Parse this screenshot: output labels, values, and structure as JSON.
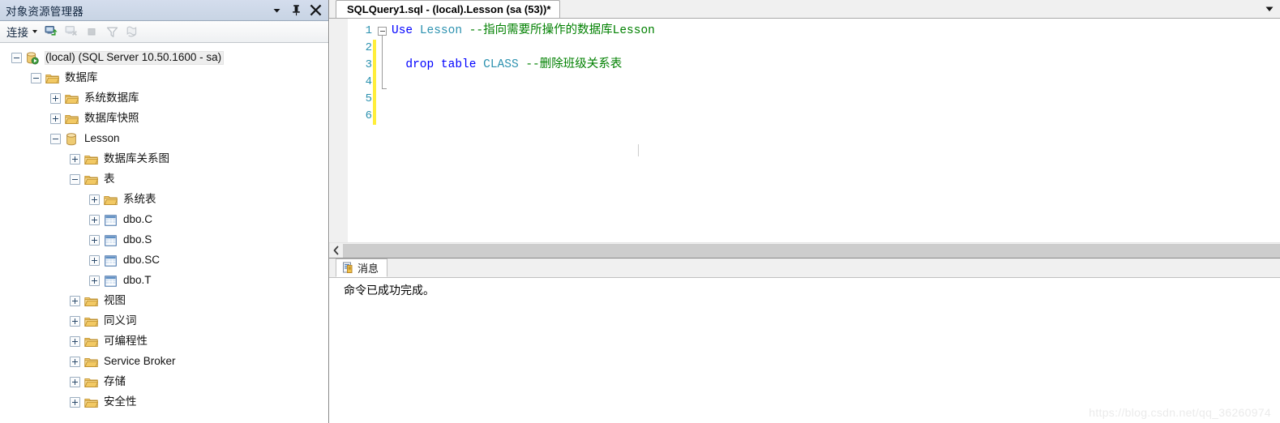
{
  "object_explorer": {
    "title": "对象资源管理器",
    "titlebar_buttons": [
      {
        "name": "window-menu-dropdown",
        "icon": "chevron-down-icon"
      },
      {
        "name": "auto-hide-pin",
        "icon": "pin-icon"
      },
      {
        "name": "close-panel",
        "icon": "close-icon"
      }
    ],
    "toolbar": {
      "connect_label": "连接",
      "buttons": [
        {
          "name": "connect-object-explorer",
          "icon": "connect-server-icon",
          "enabled": true
        },
        {
          "name": "disconnect-object-explorer",
          "icon": "disconnect-server-icon",
          "enabled": false
        },
        {
          "name": "stop-action",
          "icon": "stop-icon",
          "enabled": false
        },
        {
          "name": "filter",
          "icon": "filter-funnel-icon",
          "enabled": false
        },
        {
          "name": "refresh-script",
          "icon": "script-refresh-icon",
          "enabled": false
        }
      ]
    },
    "tree": [
      {
        "label": "(local) (SQL Server 10.50.1600 - sa)",
        "depth": 0,
        "state": "expanded",
        "icon": "server-icon",
        "selected": true
      },
      {
        "label": "数据库",
        "depth": 1,
        "state": "expanded",
        "icon": "folder-icon",
        "selected": false
      },
      {
        "label": "系统数据库",
        "depth": 2,
        "state": "collapsed",
        "icon": "folder-icon",
        "selected": false
      },
      {
        "label": "数据库快照",
        "depth": 2,
        "state": "collapsed",
        "icon": "folder-icon",
        "selected": false
      },
      {
        "label": "Lesson",
        "depth": 2,
        "state": "expanded",
        "icon": "database-icon",
        "selected": false
      },
      {
        "label": "数据库关系图",
        "depth": 3,
        "state": "collapsed",
        "icon": "folder-icon",
        "selected": false
      },
      {
        "label": "表",
        "depth": 3,
        "state": "expanded",
        "icon": "folder-icon",
        "selected": false
      },
      {
        "label": "系统表",
        "depth": 4,
        "state": "collapsed",
        "icon": "folder-icon",
        "selected": false
      },
      {
        "label": "dbo.C",
        "depth": 4,
        "state": "collapsed",
        "icon": "table-icon",
        "selected": false
      },
      {
        "label": "dbo.S",
        "depth": 4,
        "state": "collapsed",
        "icon": "table-icon",
        "selected": false
      },
      {
        "label": "dbo.SC",
        "depth": 4,
        "state": "collapsed",
        "icon": "table-icon",
        "selected": false
      },
      {
        "label": "dbo.T",
        "depth": 4,
        "state": "collapsed",
        "icon": "table-icon",
        "selected": false
      },
      {
        "label": "视图",
        "depth": 3,
        "state": "collapsed",
        "icon": "folder-icon",
        "selected": false
      },
      {
        "label": "同义词",
        "depth": 3,
        "state": "collapsed",
        "icon": "folder-icon",
        "selected": false
      },
      {
        "label": "可编程性",
        "depth": 3,
        "state": "collapsed",
        "icon": "folder-icon",
        "selected": false
      },
      {
        "label": "Service Broker",
        "depth": 3,
        "state": "collapsed",
        "icon": "folder-icon",
        "selected": false
      },
      {
        "label": "存储",
        "depth": 3,
        "state": "collapsed",
        "icon": "folder-icon",
        "selected": false
      },
      {
        "label": "安全性",
        "depth": 3,
        "state": "collapsed",
        "icon": "folder-icon",
        "selected": false
      }
    ]
  },
  "editor": {
    "tab_title": "SQLQuery1.sql - (local).Lesson (sa (53))*",
    "tabstrip_overflow_icon": "chevron-down-icon",
    "line_numbers": [
      "1",
      "2",
      "3",
      "4",
      "5",
      "6"
    ],
    "change_bar_lines": [
      2,
      3,
      4,
      5,
      6
    ],
    "lines": [
      {
        "number": "1",
        "tokens": [
          {
            "text": "Use",
            "type": "keyword"
          },
          {
            "text": " ",
            "type": "plain"
          },
          {
            "text": "Lesson",
            "type": "object"
          },
          {
            "text": " ",
            "type": "plain"
          },
          {
            "text": "--指向需要所操作的数据库Lesson",
            "type": "comment"
          }
        ]
      },
      {
        "number": "2",
        "tokens": []
      },
      {
        "number": "3",
        "tokens": [
          {
            "text": "  ",
            "type": "plain"
          },
          {
            "text": "drop",
            "type": "keyword"
          },
          {
            "text": " ",
            "type": "plain"
          },
          {
            "text": "table",
            "type": "keyword"
          },
          {
            "text": " ",
            "type": "plain"
          },
          {
            "text": "CLASS",
            "type": "object"
          },
          {
            "text": " ",
            "type": "plain"
          },
          {
            "text": "--删除班级关系表",
            "type": "comment"
          }
        ]
      },
      {
        "number": "4",
        "tokens": []
      },
      {
        "number": "5",
        "tokens": []
      },
      {
        "number": "6",
        "tokens": []
      }
    ],
    "hscroll": {
      "left_arrow_icon": "chevron-left-icon"
    }
  },
  "results": {
    "tabs": [
      {
        "label": "消息",
        "icon": "messages-icon",
        "active": true
      }
    ],
    "message_lines": [
      "命令已成功完成。"
    ]
  },
  "watermark": "https://blog.csdn.net/qq_36260974",
  "colors": {
    "panel_header": "#c8d4e4",
    "keyword": "#0000ff",
    "object": "#2b91af",
    "comment": "#008000",
    "line_number": "#2b91af",
    "change_bar": "#ffee3a"
  }
}
